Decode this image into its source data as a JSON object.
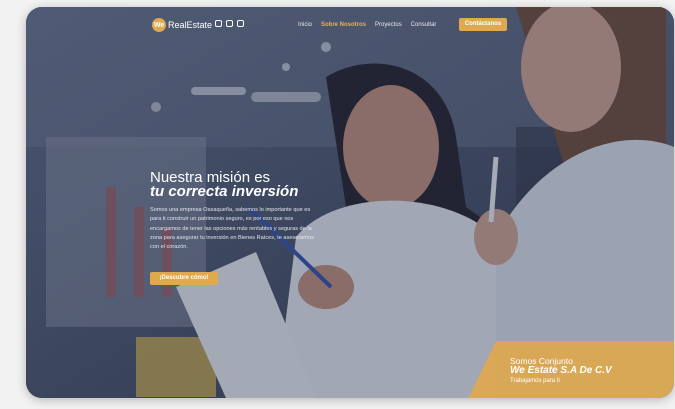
{
  "header": {
    "logo_badge": "We",
    "logo_text": "RealEstate",
    "social_icons": [
      "facebook-icon",
      "instagram-icon",
      "linkedin-icon"
    ],
    "nav": [
      {
        "label": "Inicio",
        "active": false
      },
      {
        "label": "Sobre Nosotros",
        "active": true
      },
      {
        "label": "Proyectos",
        "active": false
      },
      {
        "label": "Consultar",
        "active": false
      }
    ],
    "contact_label": "Contáctanos"
  },
  "hero": {
    "title_line1": "Nuestra misión es",
    "title_line2": "tu correcta inversión",
    "description": "Somos una empresa Oaxaqueña, sabemos lo importante que es para ti construir un patrimonio seguro, es por eso que nos encargamos de tener las opciones más rentables y seguras de la zona para asegurar tu inversión en Bienes Raíces, te asesoramos con el corazón.",
    "cta_label": "¡Descubre cómo!"
  },
  "promo": {
    "line1": "Somos Conjunto",
    "line2": "We Estate S.A De C.V",
    "line3": "Trabajamos para ti"
  },
  "colors": {
    "accent": "#e0a94d",
    "active_nav": "#e6b15c",
    "overlay": "#3c4a66"
  }
}
